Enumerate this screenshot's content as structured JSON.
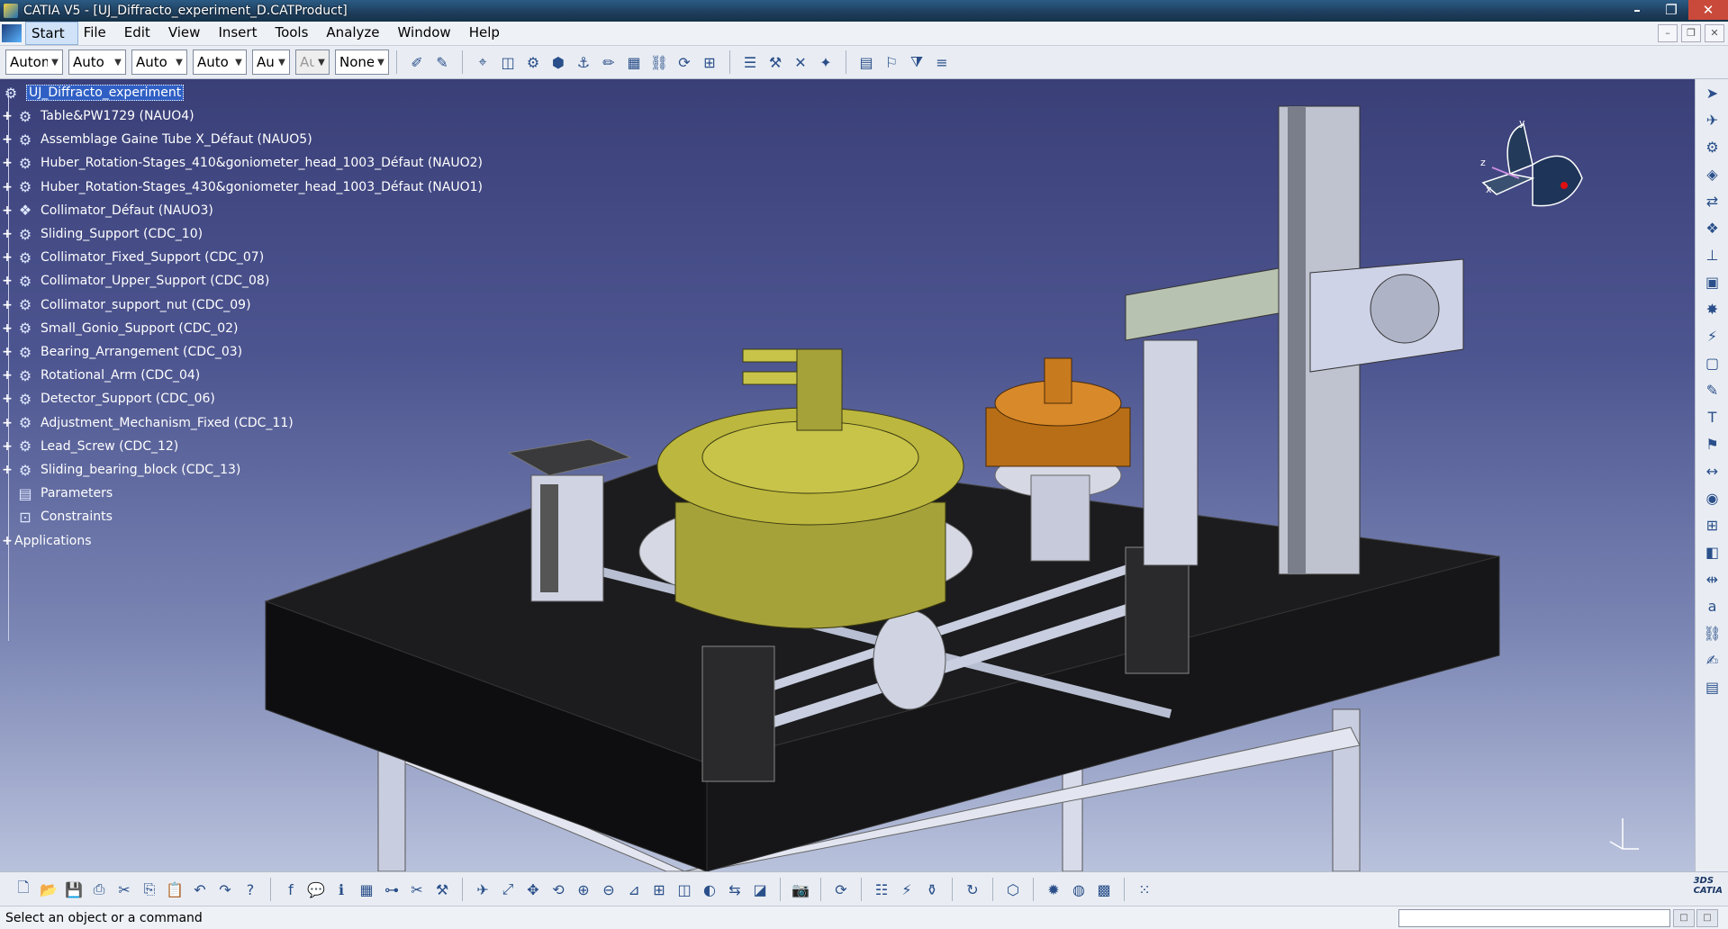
{
  "window": {
    "title": "CATIA V5 - [UJ_Diffracto_experiment_D.CATProduct]",
    "controls": {
      "minimize": "–",
      "maximize": "❐",
      "close": "✕"
    },
    "mdi_controls": {
      "minimize": "–",
      "maximize": "❐",
      "close": "✕"
    }
  },
  "menu": {
    "items": [
      "Start",
      "File",
      "Edit",
      "View",
      "Insert",
      "Tools",
      "Analyze",
      "Window",
      "Help"
    ],
    "active": "Start"
  },
  "toolbar_top": {
    "combos": [
      {
        "value": "Automa",
        "disabled": false
      },
      {
        "value": "Auto",
        "disabled": false
      },
      {
        "value": "Auto",
        "disabled": false
      },
      {
        "value": "Auto",
        "disabled": false
      },
      {
        "value": "Aut",
        "disabled": false
      },
      {
        "value": "Aut",
        "disabled": true
      },
      {
        "value": "None",
        "disabled": false
      }
    ],
    "icon_groups": [
      [
        "paint-brush-icon",
        "format-painter-icon"
      ],
      [
        "snap-icon",
        "3d-box-icon",
        "cog-move-icon",
        "part-body-icon",
        "anchor-icon",
        "pencil-icon",
        "selection-icon",
        "chain-icon",
        "refresh-icon",
        "grid-icon"
      ],
      [
        "catalog-icon",
        "fix-icon",
        "measure-icon",
        "sparkle-icon"
      ],
      [
        "bom-icon",
        "bookmark-icon",
        "filter-icon",
        "list-icon"
      ]
    ]
  },
  "tree": {
    "root": "UJ_Diffracto_experiment",
    "items": [
      {
        "label": "Table&PW1729 (NAUO4)",
        "icon": "assembly-icon"
      },
      {
        "label": "Assemblage Gaine Tube X_Défaut (NAUO5)",
        "icon": "assembly-icon"
      },
      {
        "label": "Huber_Rotation-Stages_410&goniometer_head_1003_Défaut (NAUO2)",
        "icon": "assembly-icon"
      },
      {
        "label": "Huber_Rotation-Stages_430&goniometer_head_1003_Défaut (NAUO1)",
        "icon": "assembly-icon"
      },
      {
        "label": "Collimator_Défaut (NAUO3)",
        "icon": "product-icon"
      },
      {
        "label": "Sliding_Support (CDC_10)",
        "icon": "part-icon"
      },
      {
        "label": "Collimator_Fixed_Support (CDC_07)",
        "icon": "part-icon"
      },
      {
        "label": "Collimator_Upper_Support (CDC_08)",
        "icon": "part-icon"
      },
      {
        "label": "Collimator_support_nut (CDC_09)",
        "icon": "part-icon"
      },
      {
        "label": "Small_Gonio_Support (CDC_02)",
        "icon": "part-icon"
      },
      {
        "label": "Bearing_Arrangement (CDC_03)",
        "icon": "part-icon"
      },
      {
        "label": "Rotational_Arm (CDC_04)",
        "icon": "part-icon"
      },
      {
        "label": "Detector_Support (CDC_06)",
        "icon": "part-icon"
      },
      {
        "label": "Adjustment_Mechanism_Fixed (CDC_11)",
        "icon": "part-icon"
      },
      {
        "label": "Lead_Screw (CDC_12)",
        "icon": "part-icon"
      },
      {
        "label": "Sliding_bearing_block (CDC_13)",
        "icon": "part-icon"
      },
      {
        "label": "Parameters",
        "icon": "parameters-icon"
      },
      {
        "label": "Constraints",
        "icon": "constraints-icon"
      }
    ],
    "applications": "Applications"
  },
  "compass": {
    "x": "x",
    "y": "y",
    "z": "z"
  },
  "toolbar_right": [
    "select-icon",
    "fly-icon",
    "gear-icon",
    "part-design-icon",
    "swap-icon",
    "product-icon",
    "constraint-icon",
    "scene-icon",
    "explode-icon",
    "clash-icon",
    "snapshot-icon",
    "annotation-icon",
    "text-icon",
    "flag-icon",
    "measure-between-icon",
    "inertia-icon",
    "group-icon",
    "section-icon",
    "distance-icon",
    "abc-icon",
    "link-icon",
    "note-icon",
    "paint-icon"
  ],
  "toolbar_bottom": [
    [
      "new-icon",
      "open-icon",
      "save-icon",
      "print-icon",
      "cut-icon",
      "copy-icon",
      "paste-icon",
      "undo-icon",
      "redo-icon",
      "whats-this-icon"
    ],
    [
      "formula-icon",
      "comment-icon",
      "knowledge-icon",
      "table-icon",
      "tree-icon",
      "scissors-icon",
      "tools-icon"
    ],
    [
      "fly-mode-icon",
      "fit-all-icon",
      "pan-icon",
      "rotate-icon",
      "zoom-in-icon",
      "zoom-out-icon",
      "normal-view-icon",
      "multi-view-icon",
      "iso-view-icon",
      "hide-show-icon",
      "swap-space-icon",
      "shading-icon"
    ],
    [
      "camera-icon"
    ],
    [
      "update-icon"
    ],
    [
      "catalog-browser-icon",
      "clash-detect-icon",
      "bottle-icon"
    ],
    [
      "sketch-icon"
    ],
    [
      "cube-icon"
    ],
    [
      "render-icon",
      "material-icon",
      "colors-icon"
    ],
    [
      "grid-dots-icon"
    ]
  ],
  "status": {
    "message": "Select an object or a command"
  }
}
